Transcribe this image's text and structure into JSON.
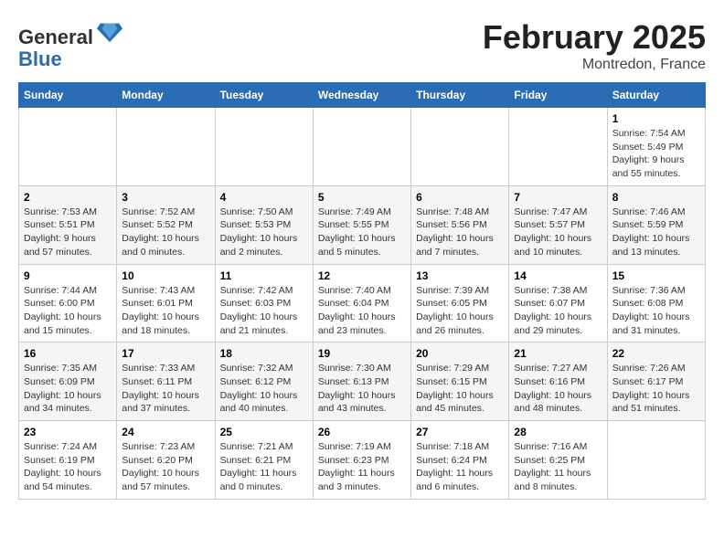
{
  "header": {
    "logo_general": "General",
    "logo_blue": "Blue",
    "month_title": "February 2025",
    "location": "Montredon, France"
  },
  "days_of_week": [
    "Sunday",
    "Monday",
    "Tuesday",
    "Wednesday",
    "Thursday",
    "Friday",
    "Saturday"
  ],
  "weeks": [
    [
      {
        "day": "",
        "info": ""
      },
      {
        "day": "",
        "info": ""
      },
      {
        "day": "",
        "info": ""
      },
      {
        "day": "",
        "info": ""
      },
      {
        "day": "",
        "info": ""
      },
      {
        "day": "",
        "info": ""
      },
      {
        "day": "1",
        "info": "Sunrise: 7:54 AM\nSunset: 5:49 PM\nDaylight: 9 hours and 55 minutes."
      }
    ],
    [
      {
        "day": "2",
        "info": "Sunrise: 7:53 AM\nSunset: 5:51 PM\nDaylight: 9 hours and 57 minutes."
      },
      {
        "day": "3",
        "info": "Sunrise: 7:52 AM\nSunset: 5:52 PM\nDaylight: 10 hours and 0 minutes."
      },
      {
        "day": "4",
        "info": "Sunrise: 7:50 AM\nSunset: 5:53 PM\nDaylight: 10 hours and 2 minutes."
      },
      {
        "day": "5",
        "info": "Sunrise: 7:49 AM\nSunset: 5:55 PM\nDaylight: 10 hours and 5 minutes."
      },
      {
        "day": "6",
        "info": "Sunrise: 7:48 AM\nSunset: 5:56 PM\nDaylight: 10 hours and 7 minutes."
      },
      {
        "day": "7",
        "info": "Sunrise: 7:47 AM\nSunset: 5:57 PM\nDaylight: 10 hours and 10 minutes."
      },
      {
        "day": "8",
        "info": "Sunrise: 7:46 AM\nSunset: 5:59 PM\nDaylight: 10 hours and 13 minutes."
      }
    ],
    [
      {
        "day": "9",
        "info": "Sunrise: 7:44 AM\nSunset: 6:00 PM\nDaylight: 10 hours and 15 minutes."
      },
      {
        "day": "10",
        "info": "Sunrise: 7:43 AM\nSunset: 6:01 PM\nDaylight: 10 hours and 18 minutes."
      },
      {
        "day": "11",
        "info": "Sunrise: 7:42 AM\nSunset: 6:03 PM\nDaylight: 10 hours and 21 minutes."
      },
      {
        "day": "12",
        "info": "Sunrise: 7:40 AM\nSunset: 6:04 PM\nDaylight: 10 hours and 23 minutes."
      },
      {
        "day": "13",
        "info": "Sunrise: 7:39 AM\nSunset: 6:05 PM\nDaylight: 10 hours and 26 minutes."
      },
      {
        "day": "14",
        "info": "Sunrise: 7:38 AM\nSunset: 6:07 PM\nDaylight: 10 hours and 29 minutes."
      },
      {
        "day": "15",
        "info": "Sunrise: 7:36 AM\nSunset: 6:08 PM\nDaylight: 10 hours and 31 minutes."
      }
    ],
    [
      {
        "day": "16",
        "info": "Sunrise: 7:35 AM\nSunset: 6:09 PM\nDaylight: 10 hours and 34 minutes."
      },
      {
        "day": "17",
        "info": "Sunrise: 7:33 AM\nSunset: 6:11 PM\nDaylight: 10 hours and 37 minutes."
      },
      {
        "day": "18",
        "info": "Sunrise: 7:32 AM\nSunset: 6:12 PM\nDaylight: 10 hours and 40 minutes."
      },
      {
        "day": "19",
        "info": "Sunrise: 7:30 AM\nSunset: 6:13 PM\nDaylight: 10 hours and 43 minutes."
      },
      {
        "day": "20",
        "info": "Sunrise: 7:29 AM\nSunset: 6:15 PM\nDaylight: 10 hours and 45 minutes."
      },
      {
        "day": "21",
        "info": "Sunrise: 7:27 AM\nSunset: 6:16 PM\nDaylight: 10 hours and 48 minutes."
      },
      {
        "day": "22",
        "info": "Sunrise: 7:26 AM\nSunset: 6:17 PM\nDaylight: 10 hours and 51 minutes."
      }
    ],
    [
      {
        "day": "23",
        "info": "Sunrise: 7:24 AM\nSunset: 6:19 PM\nDaylight: 10 hours and 54 minutes."
      },
      {
        "day": "24",
        "info": "Sunrise: 7:23 AM\nSunset: 6:20 PM\nDaylight: 10 hours and 57 minutes."
      },
      {
        "day": "25",
        "info": "Sunrise: 7:21 AM\nSunset: 6:21 PM\nDaylight: 11 hours and 0 minutes."
      },
      {
        "day": "26",
        "info": "Sunrise: 7:19 AM\nSunset: 6:23 PM\nDaylight: 11 hours and 3 minutes."
      },
      {
        "day": "27",
        "info": "Sunrise: 7:18 AM\nSunset: 6:24 PM\nDaylight: 11 hours and 6 minutes."
      },
      {
        "day": "28",
        "info": "Sunrise: 7:16 AM\nSunset: 6:25 PM\nDaylight: 11 hours and 8 minutes."
      },
      {
        "day": "",
        "info": ""
      }
    ]
  ]
}
